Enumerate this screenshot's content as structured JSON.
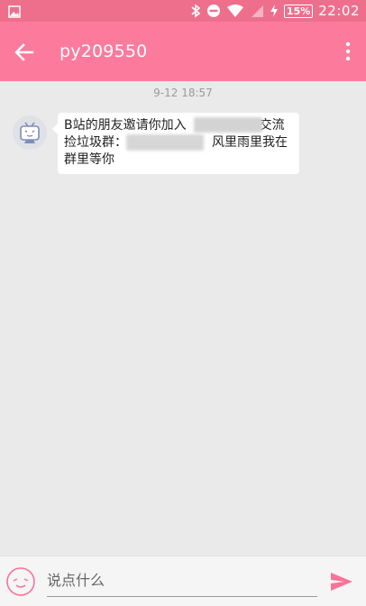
{
  "status_bar": {
    "time": "22:02",
    "battery": "15%",
    "icons": [
      "image-icon",
      "bluetooth-icon",
      "do-not-disturb-icon",
      "wifi-icon",
      "signal-icon",
      "charging-icon",
      "battery-icon"
    ]
  },
  "header": {
    "title": "py209550"
  },
  "chat": {
    "timestamp": "9-12 18:57",
    "message": {
      "line1_start": "B站的朋友邀请你加入",
      "line1_end": "交流",
      "line2_start": "捡垃圾群：",
      "line2_end": "风里雨里我在",
      "line3": "群里等你"
    }
  },
  "input": {
    "placeholder": "说点什么",
    "value": ""
  },
  "colors": {
    "status_bar": "#ee6f8c",
    "app_bar": "#fc7b9d",
    "accent": "#fb7299",
    "background": "#eaeaea"
  }
}
